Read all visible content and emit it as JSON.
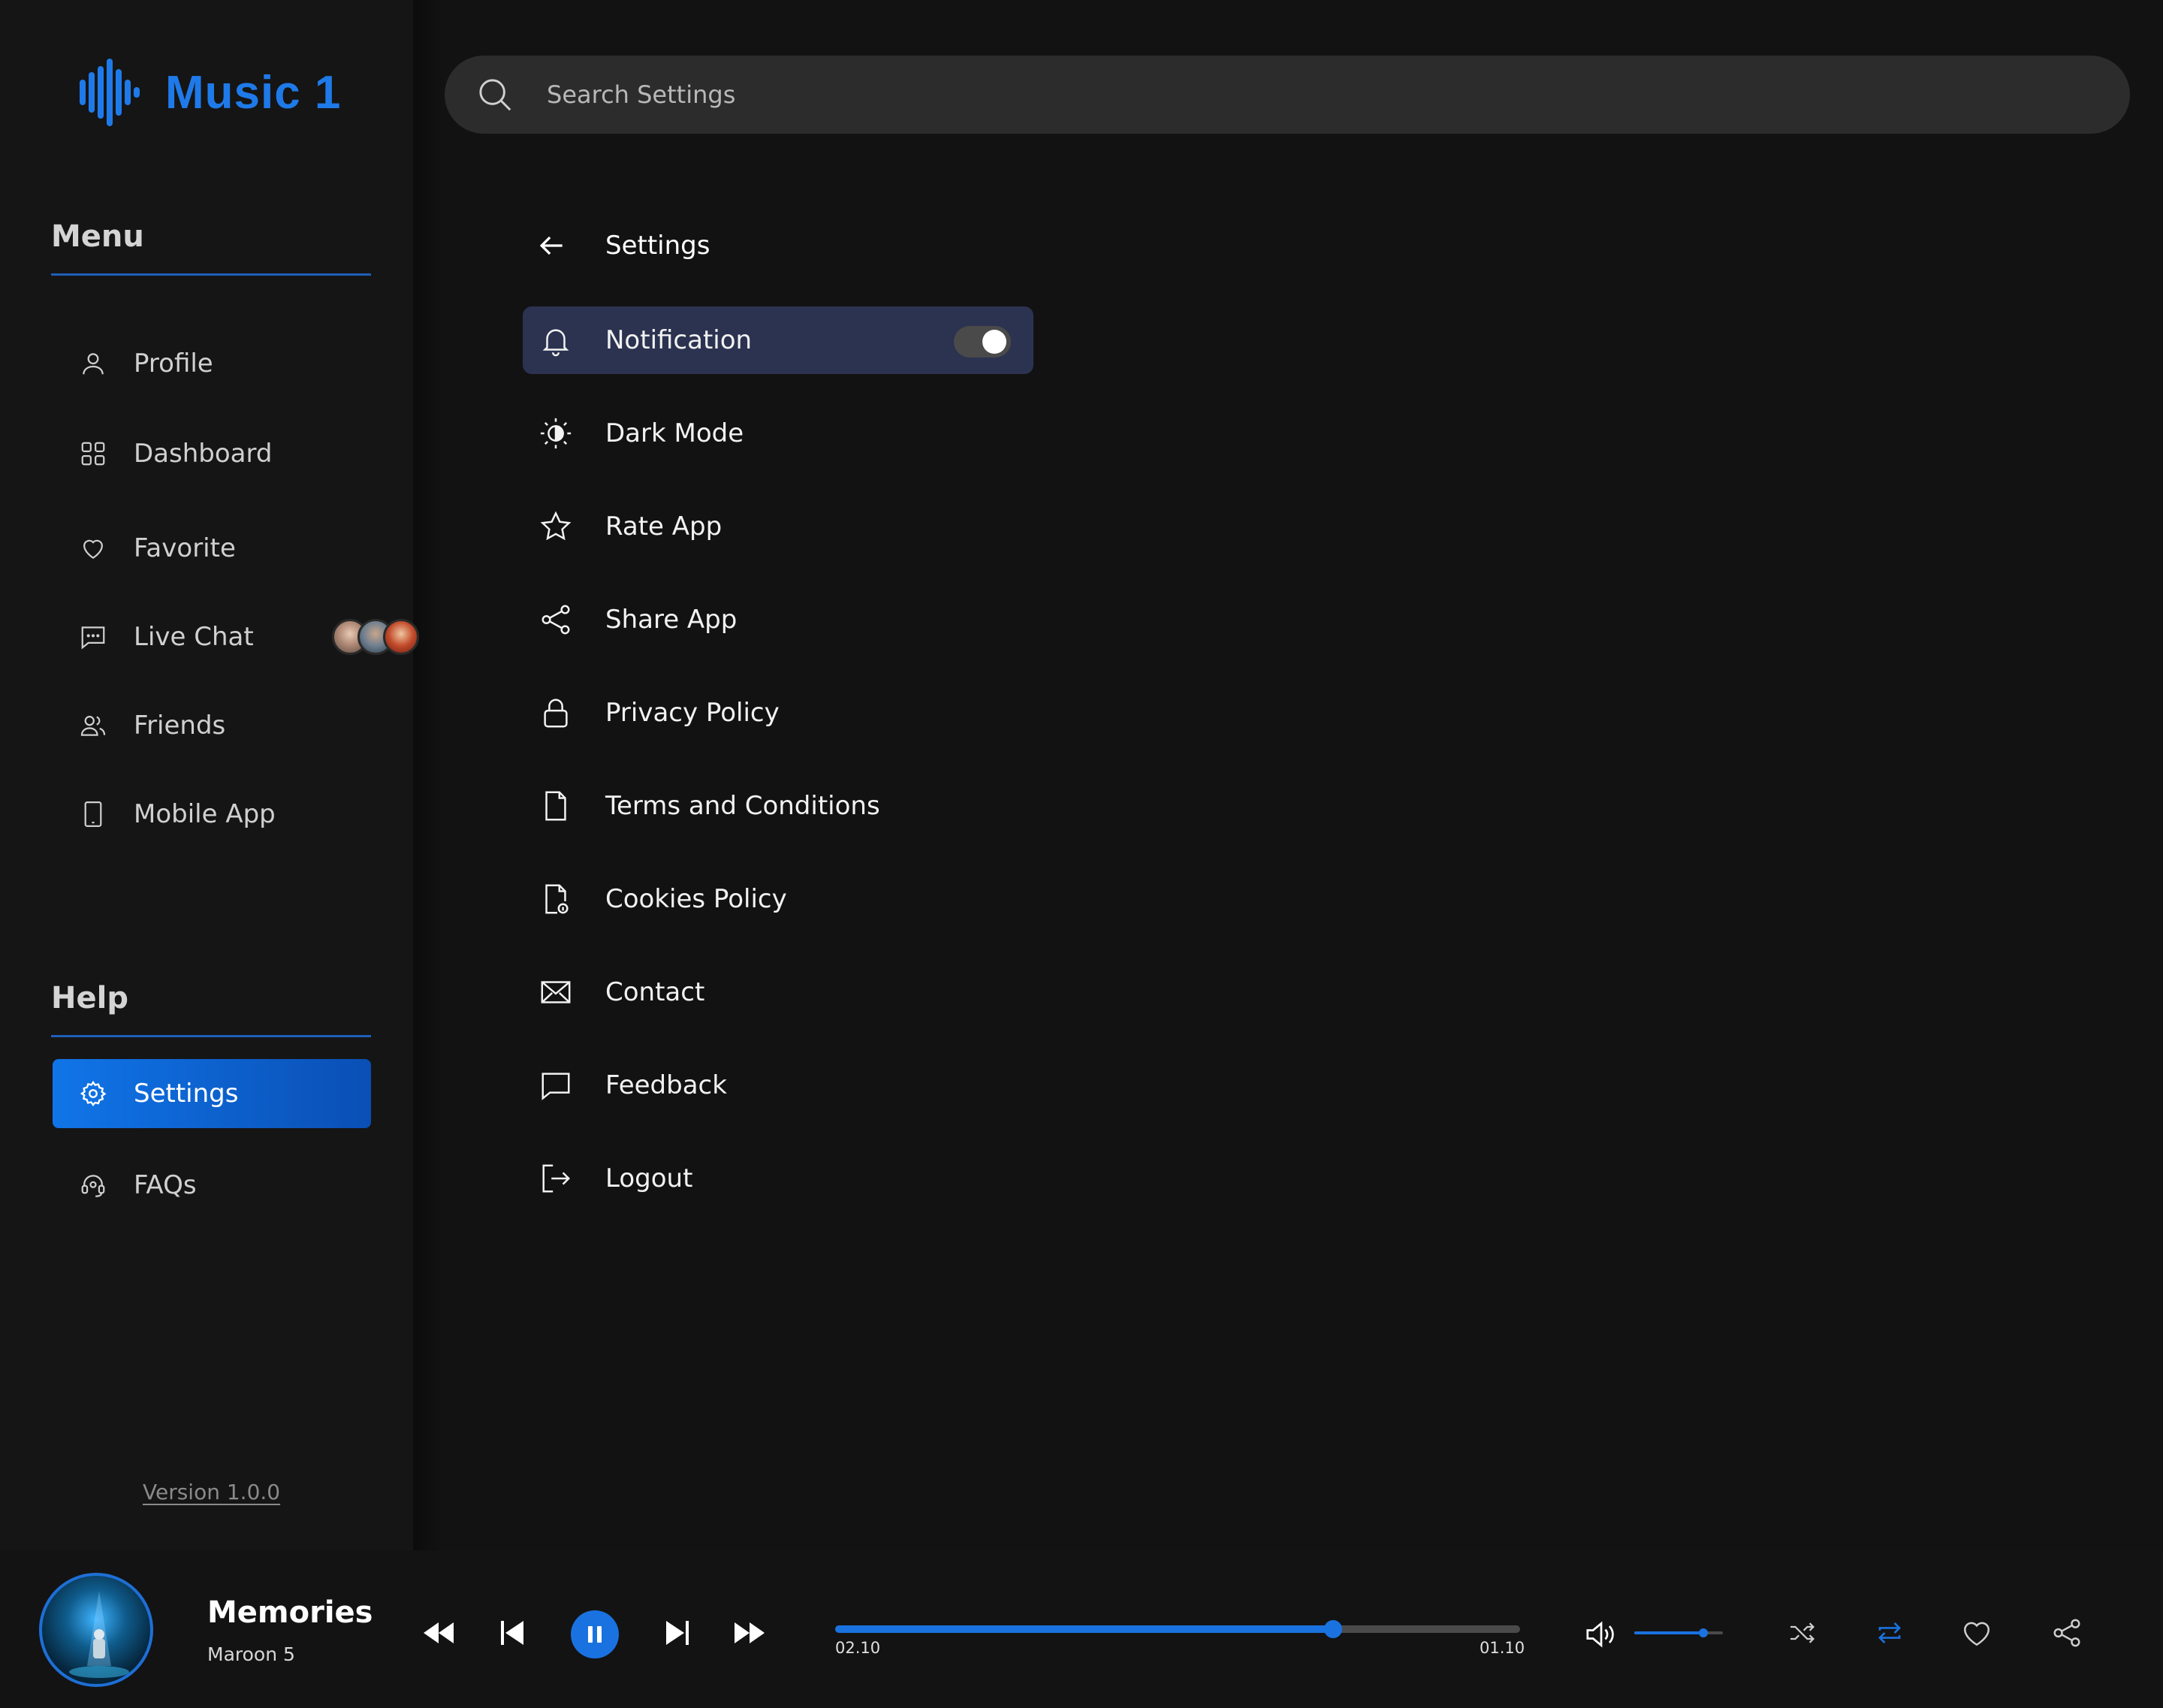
{
  "app": {
    "name": "Music 1",
    "accent": "#1a72e0",
    "background": "#121212"
  },
  "search": {
    "placeholder": "Search Settings"
  },
  "sidebar": {
    "menu_title": "Menu",
    "menu_items": [
      {
        "label": "Profile",
        "icon": "user-icon"
      },
      {
        "label": "Dashboard",
        "icon": "grid-icon"
      },
      {
        "label": "Favorite",
        "icon": "heart-icon"
      },
      {
        "label": "Live Chat",
        "icon": "chat-icon"
      },
      {
        "label": "Friends",
        "icon": "users-icon"
      },
      {
        "label": "Mobile App",
        "icon": "mobile-icon"
      }
    ],
    "help_title": "Help",
    "help_items": [
      {
        "label": "Settings",
        "icon": "gear-icon",
        "active": true
      },
      {
        "label": "FAQs",
        "icon": "headset-icon"
      }
    ],
    "version": "Version 1.0.0"
  },
  "settings": {
    "title": "Settings",
    "items": [
      {
        "label": "Notification",
        "icon": "bell-icon",
        "highlighted": true,
        "toggle": true
      },
      {
        "label": "Dark Mode",
        "icon": "contrast-icon"
      },
      {
        "label": "Rate App",
        "icon": "star-icon"
      },
      {
        "label": "Share App",
        "icon": "share-icon"
      },
      {
        "label": "Privacy Policy",
        "icon": "lock-icon"
      },
      {
        "label": "Terms and Conditions",
        "icon": "file-icon"
      },
      {
        "label": "Cookies Policy",
        "icon": "file-info-icon"
      },
      {
        "label": "Contact",
        "icon": "mail-icon"
      },
      {
        "label": "Feedback",
        "icon": "message-icon"
      },
      {
        "label": "Logout",
        "icon": "logout-icon"
      }
    ]
  },
  "player": {
    "song_title": "Memories",
    "artist": "Maroon 5",
    "elapsed": "02.10",
    "remaining": "01.10",
    "progress": 0.727,
    "volume": 0.78,
    "state": "playing"
  }
}
